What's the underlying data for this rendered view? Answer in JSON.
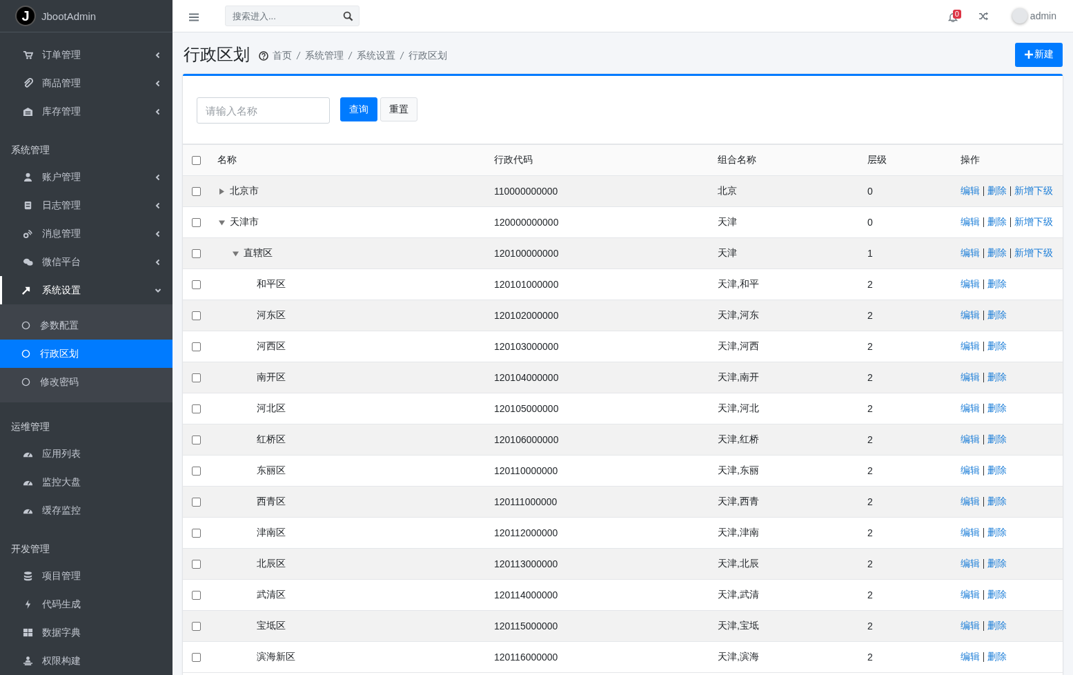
{
  "sidebar": {
    "logo_mark": "J",
    "brand": "JbootAdmin",
    "sections": [
      {
        "items": [
          {
            "label": "订单管理",
            "expanded": false,
            "selected": false
          },
          {
            "label": "商品管理",
            "expanded": false,
            "selected": false
          },
          {
            "label": "库存管理",
            "expanded": false,
            "selected": false
          }
        ]
      },
      {
        "title": "系统管理",
        "items": [
          {
            "label": "账户管理",
            "expanded": false,
            "selected": false
          },
          {
            "label": "日志管理",
            "expanded": false,
            "selected": false
          },
          {
            "label": "消息管理",
            "expanded": false,
            "selected": false
          },
          {
            "label": "微信平台",
            "expanded": false,
            "selected": false
          },
          {
            "label": "系统设置",
            "expanded": true,
            "selected": true,
            "children": [
              {
                "label": "参数配置",
                "selected": false
              },
              {
                "label": "行政区划",
                "selected": true
              },
              {
                "label": "修改密码",
                "selected": false
              }
            ]
          }
        ]
      },
      {
        "title": "运维管理",
        "items": [
          {
            "label": "应用列表",
            "selected": false
          },
          {
            "label": "监控大盘",
            "selected": false
          },
          {
            "label": "缓存监控",
            "selected": false
          }
        ]
      },
      {
        "title": "开发管理",
        "items": [
          {
            "label": "项目管理",
            "selected": false
          },
          {
            "label": "代码生成",
            "selected": false
          },
          {
            "label": "数据字典",
            "selected": false
          },
          {
            "label": "权限构建",
            "selected": false
          }
        ]
      }
    ]
  },
  "topbar": {
    "search": {
      "placeholder": "搜索进入..."
    },
    "notifications": "0",
    "user": "admin"
  },
  "page": {
    "title": "行政区划",
    "breadcrumb": [
      "首页",
      "系统管理",
      "系统设置",
      "行政区划"
    ],
    "new_button": "新建"
  },
  "filter": {
    "placeholder": "请输入名称",
    "buttons": [
      {
        "label": "查询",
        "kind": "primary"
      },
      {
        "label": "重置",
        "kind": "default"
      }
    ]
  },
  "table": {
    "select_all": {
      "checked": false
    },
    "columns": [
      "名称",
      "行政代码",
      "组合名称",
      "层级",
      "操作"
    ],
    "rows": [
      {
        "name": "北京市",
        "code": "110000000000",
        "full_name": "北京",
        "level": "0",
        "checked": false,
        "expanded": false,
        "actions": [
          "编辑",
          "删除",
          "新增下级"
        ]
      },
      {
        "name": "天津市",
        "code": "120000000000",
        "full_name": "天津",
        "level": "0",
        "checked": false,
        "expanded": true,
        "actions": [
          "编辑",
          "删除",
          "新增下级"
        ],
        "children": [
          {
            "name": "直辖区",
            "code": "120100000000",
            "full_name": "天津",
            "level": "1",
            "checked": false,
            "expanded": true,
            "actions": [
              "编辑",
              "删除",
              "新增下级"
            ],
            "children": [
              {
                "name": "和平区",
                "code": "120101000000",
                "full_name": "天津,和平",
                "level": "2",
                "checked": false,
                "actions": [
                  "编辑",
                  "删除"
                ]
              },
              {
                "name": "河东区",
                "code": "120102000000",
                "full_name": "天津,河东",
                "level": "2",
                "checked": false,
                "actions": [
                  "编辑",
                  "删除"
                ]
              },
              {
                "name": "河西区",
                "code": "120103000000",
                "full_name": "天津,河西",
                "level": "2",
                "checked": false,
                "actions": [
                  "编辑",
                  "删除"
                ]
              },
              {
                "name": "南开区",
                "code": "120104000000",
                "full_name": "天津,南开",
                "level": "2",
                "checked": false,
                "actions": [
                  "编辑",
                  "删除"
                ]
              },
              {
                "name": "河北区",
                "code": "120105000000",
                "full_name": "天津,河北",
                "level": "2",
                "checked": false,
                "actions": [
                  "编辑",
                  "删除"
                ]
              },
              {
                "name": "红桥区",
                "code": "120106000000",
                "full_name": "天津,红桥",
                "level": "2",
                "checked": false,
                "actions": [
                  "编辑",
                  "删除"
                ]
              },
              {
                "name": "东丽区",
                "code": "120110000000",
                "full_name": "天津,东丽",
                "level": "2",
                "checked": false,
                "actions": [
                  "编辑",
                  "删除"
                ]
              },
              {
                "name": "西青区",
                "code": "120111000000",
                "full_name": "天津,西青",
                "level": "2",
                "checked": false,
                "actions": [
                  "编辑",
                  "删除"
                ]
              },
              {
                "name": "津南区",
                "code": "120112000000",
                "full_name": "天津,津南",
                "level": "2",
                "checked": false,
                "actions": [
                  "编辑",
                  "删除"
                ]
              },
              {
                "name": "北辰区",
                "code": "120113000000",
                "full_name": "天津,北辰",
                "level": "2",
                "checked": false,
                "actions": [
                  "编辑",
                  "删除"
                ]
              },
              {
                "name": "武清区",
                "code": "120114000000",
                "full_name": "天津,武清",
                "level": "2",
                "checked": false,
                "actions": [
                  "编辑",
                  "删除"
                ]
              },
              {
                "name": "宝坻区",
                "code": "120115000000",
                "full_name": "天津,宝坻",
                "level": "2",
                "checked": false,
                "actions": [
                  "编辑",
                  "删除"
                ]
              },
              {
                "name": "滨海新区",
                "code": "120116000000",
                "full_name": "天津,滨海",
                "level": "2",
                "checked": false,
                "actions": [
                  "编辑",
                  "删除"
                ]
              }
            ]
          }
        ]
      }
    ]
  }
}
